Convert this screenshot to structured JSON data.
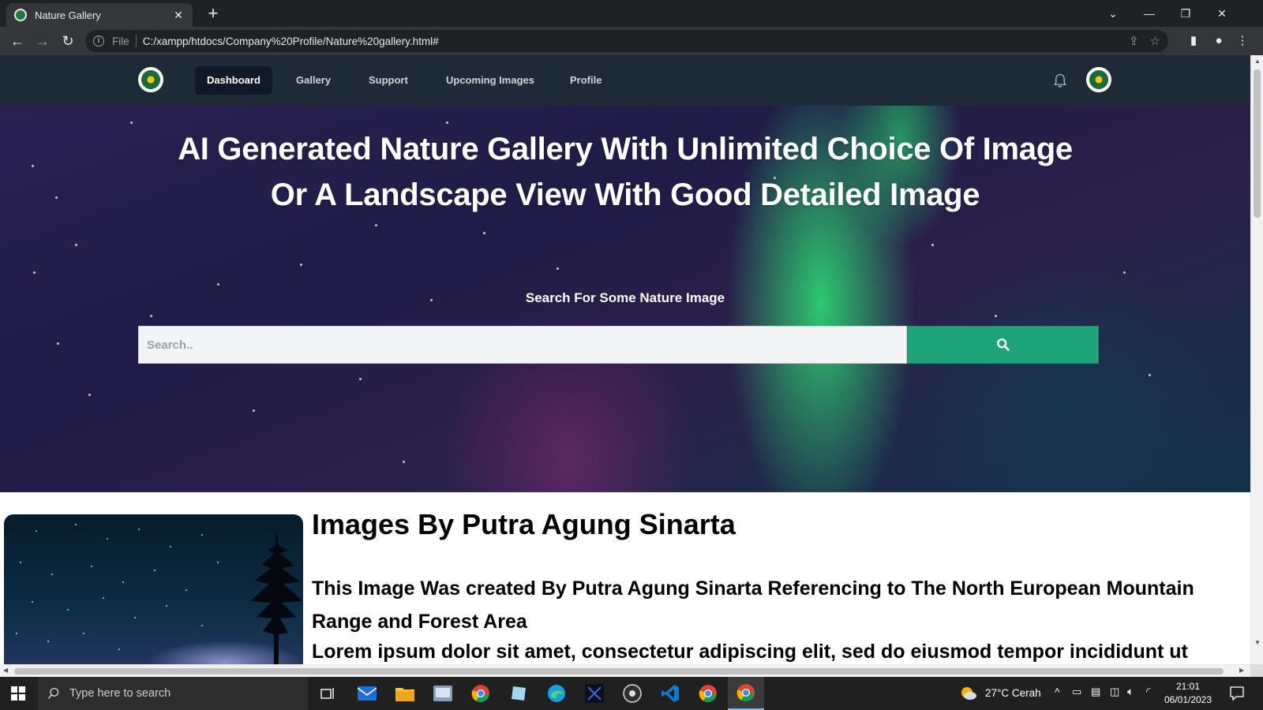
{
  "browser": {
    "tab_title": "Nature Gallery",
    "url_scheme": "File",
    "url": "C:/xampp/htdocs/Company%20Profile/Nature%20gallery.html#"
  },
  "nav": {
    "links": [
      "Dashboard",
      "Gallery",
      "Support",
      "Upcoming Images",
      "Profile"
    ],
    "active": "Dashboard"
  },
  "hero": {
    "title_line1": "AI Generated Nature Gallery With Unlimited Choice Of Image",
    "title_line2": "Or A Landscape View With Good Detailed Image",
    "search_label": "Search For Some Nature Image",
    "search_placeholder": "Search.."
  },
  "content": {
    "title": "Images By Putra Agung Sinarta",
    "paragraph1": "This Image Was created By Putra Agung Sinarta Referencing to The North European Mountain Range and Forest Area",
    "paragraph2": "Lorem ipsum dolor sit amet, consectetur adipiscing elit, sed do eiusmod tempor incididunt ut"
  },
  "taskbar": {
    "search_placeholder": "Type here to search",
    "weather": "27°C Cerah",
    "time": "21:01",
    "date": "06/01/2023"
  },
  "colors": {
    "nav_bg": "#1f2a37",
    "search_button": "#1fa47a",
    "browser_dark": "#202124"
  }
}
